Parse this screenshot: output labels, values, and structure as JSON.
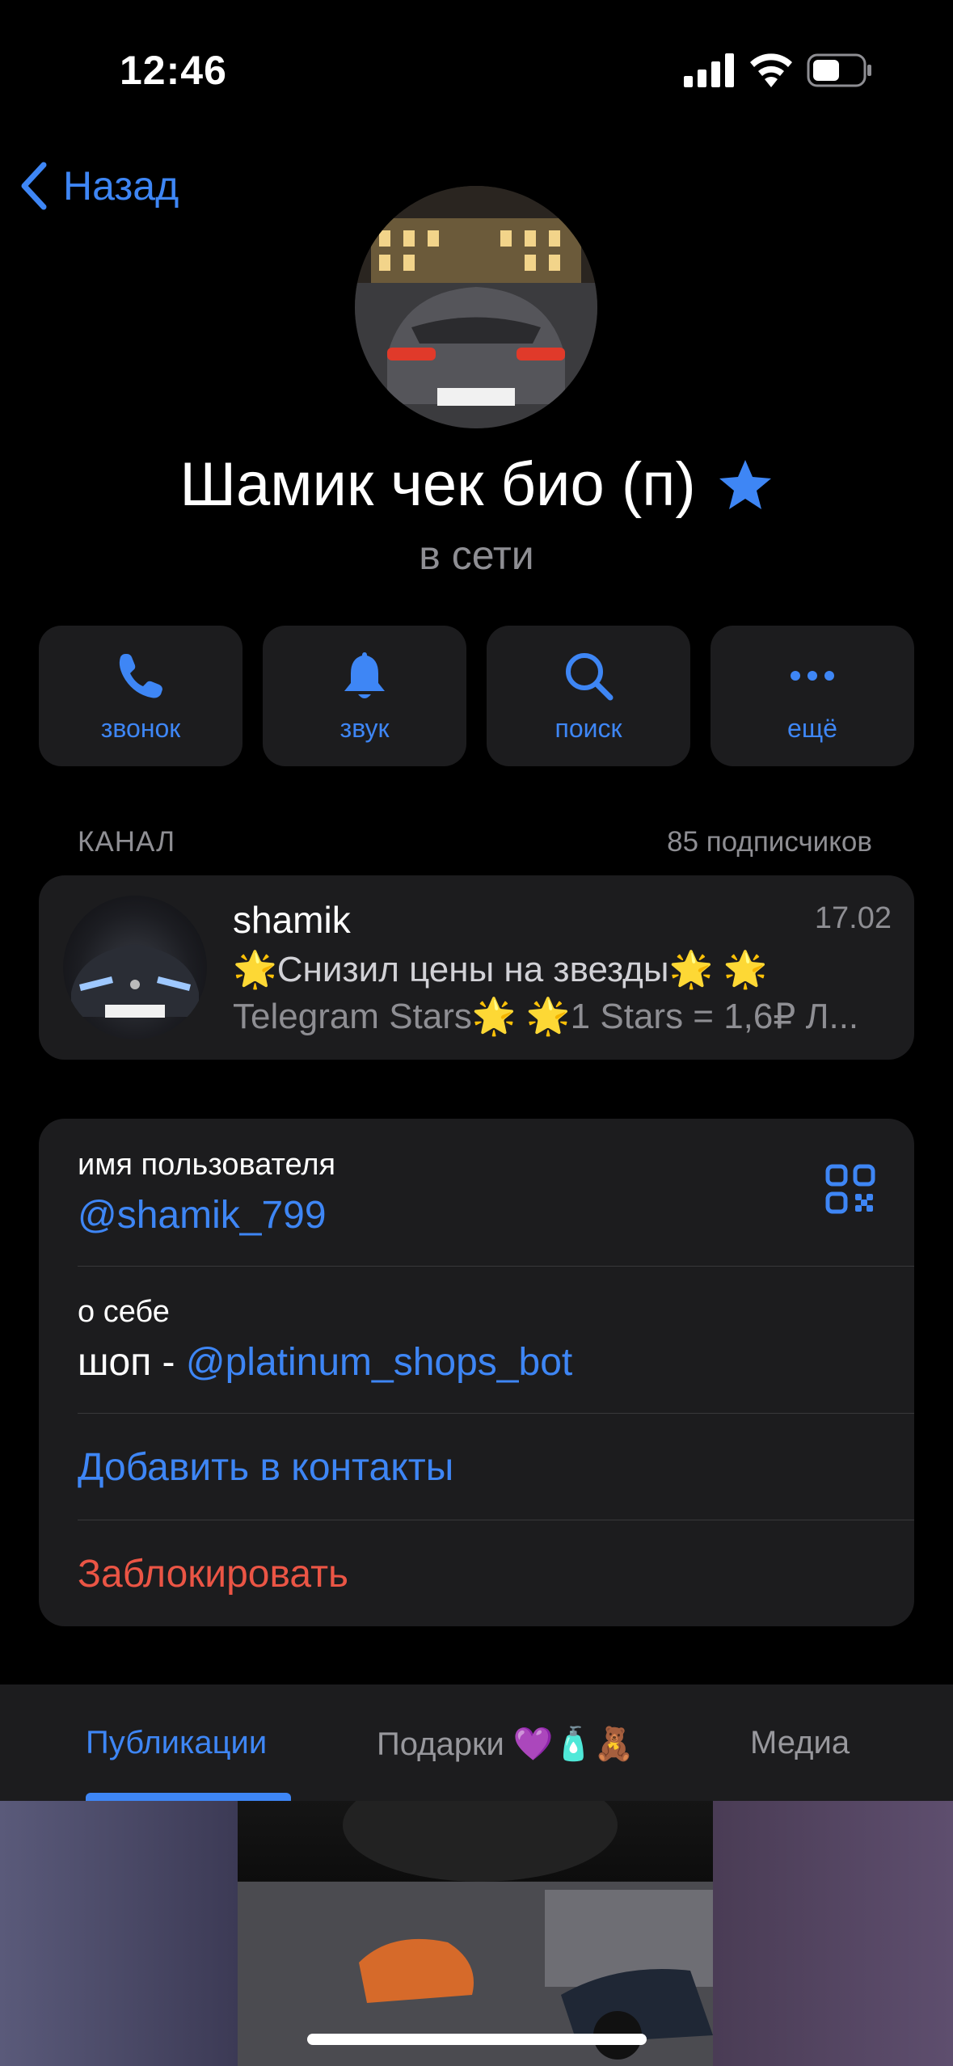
{
  "status_bar": {
    "time": "12:46"
  },
  "nav": {
    "back_label": "Назад"
  },
  "profile": {
    "name": "Шамик чек био (п)",
    "status": "в сети"
  },
  "actions": [
    {
      "label": "звонок",
      "icon": "phone-icon"
    },
    {
      "label": "звук",
      "icon": "bell-icon"
    },
    {
      "label": "поиск",
      "icon": "search-icon"
    },
    {
      "label": "ещё",
      "icon": "more-icon"
    }
  ],
  "channel": {
    "section_label": "КАНАЛ",
    "subscribers": "85 подписчиков",
    "name": "shamik",
    "date": "17.02",
    "line1": "🌟Снизил цены на звезды🌟  🌟",
    "line2": "Telegram Stars🌟  🌟1 Stars = 1,6₽ Л..."
  },
  "info": {
    "username_label": "имя пользователя",
    "username": "@shamik_799",
    "about_label": "о себе",
    "about_prefix": "шоп - ",
    "about_link": "@platinum_shops_bot",
    "add_contact": "Добавить в контакты",
    "block": "Заблокировать"
  },
  "tabs": [
    {
      "label": "Публикации",
      "active": true
    },
    {
      "label": "Подарки 💜🧴🧸",
      "active": false
    },
    {
      "label": "Медиа",
      "active": false
    }
  ],
  "colors": {
    "accent": "#3e86f5",
    "danger": "#eb5545",
    "card": "#1c1c1e",
    "secondary_text": "#8e8e93"
  }
}
